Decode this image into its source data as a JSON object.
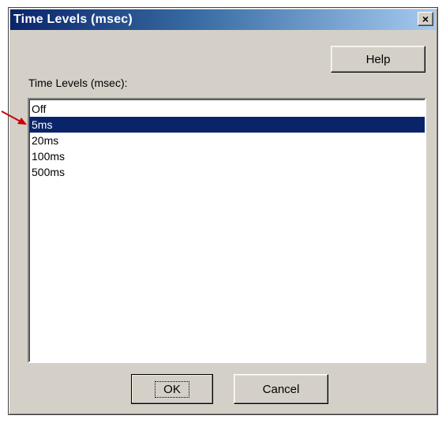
{
  "window": {
    "title": "Time Levels (msec)",
    "close_label": "×"
  },
  "buttons": {
    "help": "Help",
    "ok": "OK",
    "cancel": "Cancel"
  },
  "list": {
    "label": "Time Levels (msec):",
    "items": [
      "Off",
      "5ms",
      "20ms",
      "100ms",
      "500ms"
    ],
    "selected": "5ms"
  },
  "colors": {
    "selection": "#0a246a",
    "annotation_arrow": "#cc0000"
  }
}
